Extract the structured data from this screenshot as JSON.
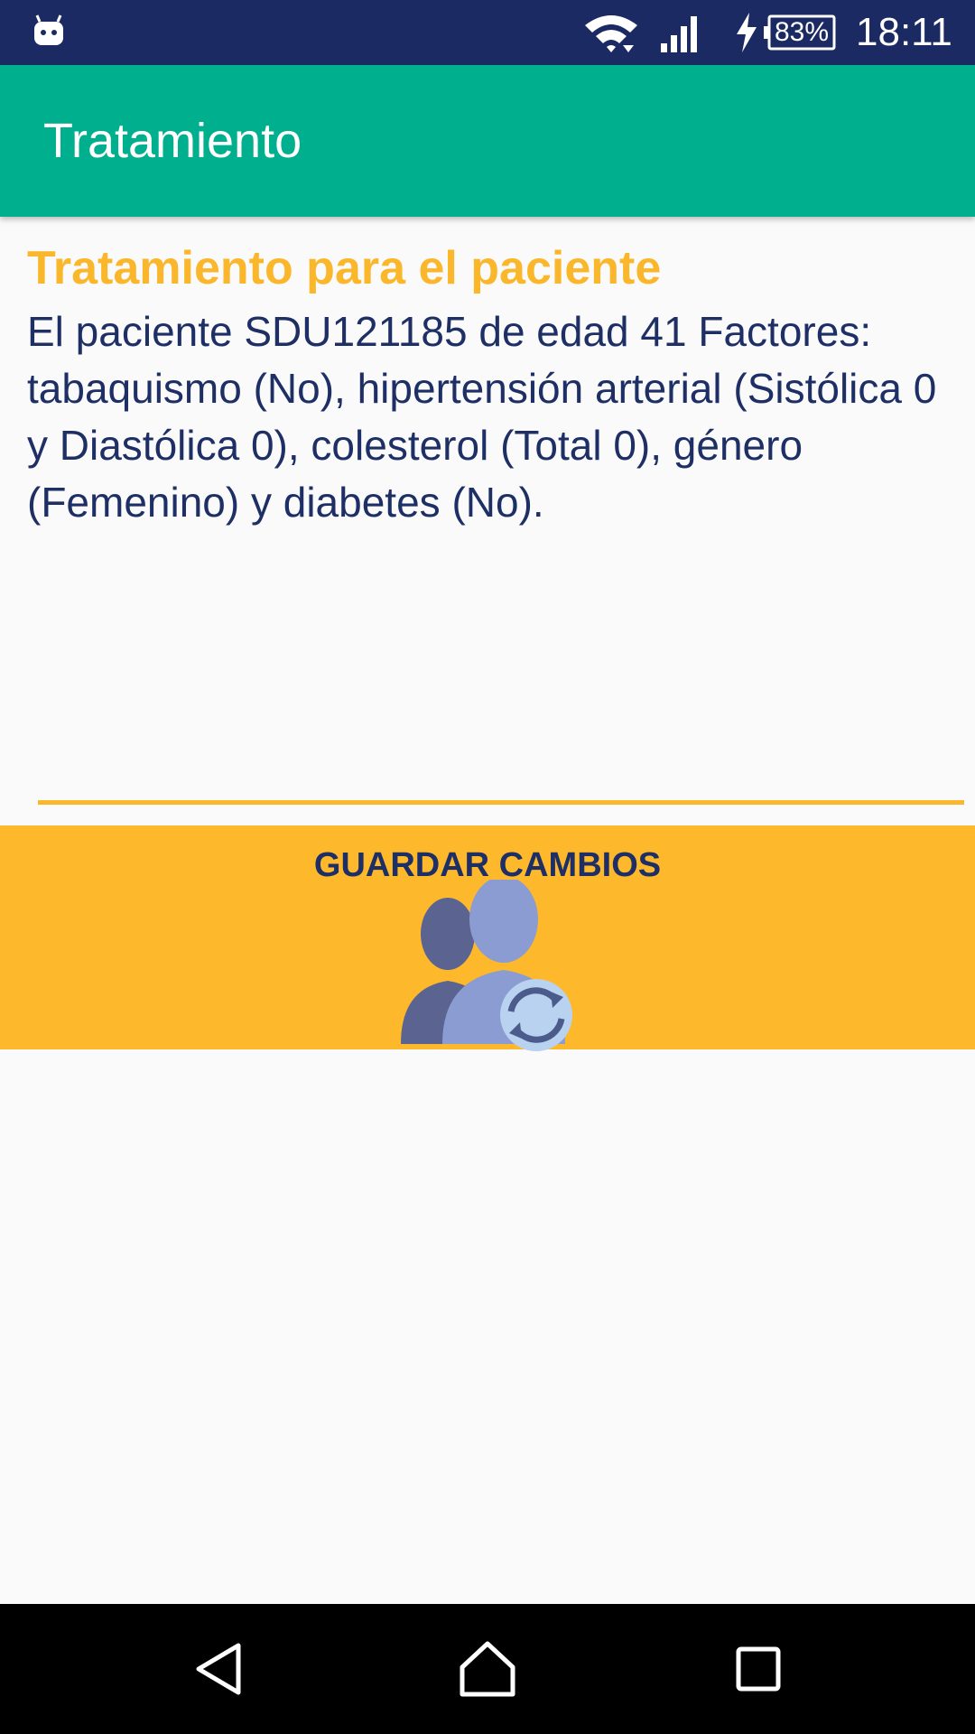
{
  "status_bar": {
    "battery_percent": "83%",
    "time": "18:11",
    "icons": [
      "android-notification-icon",
      "wifi-icon",
      "cell-signal-icon",
      "charging-bolt-icon",
      "battery-icon"
    ],
    "background": "#1B2A63"
  },
  "app_bar": {
    "title": "Tratamiento",
    "background": "#00AF8D"
  },
  "content": {
    "heading": "Tratamiento para el paciente",
    "description": "El paciente SDU121185 de edad 41 Factores: tabaquismo (No), hipertensión arterial (Sistólica 0 y Diastólica 0), colesterol (Total 0), género (Femenino) y diabetes (No).",
    "heading_color": "#FBB72C",
    "text_color": "#1E2F66"
  },
  "save_button": {
    "label": "GUARDAR CAMBIOS",
    "icon": "users-sync-icon",
    "background": "#FDB92B"
  },
  "nav_bar": {
    "buttons": [
      "back-icon",
      "home-icon",
      "recents-icon"
    ]
  }
}
